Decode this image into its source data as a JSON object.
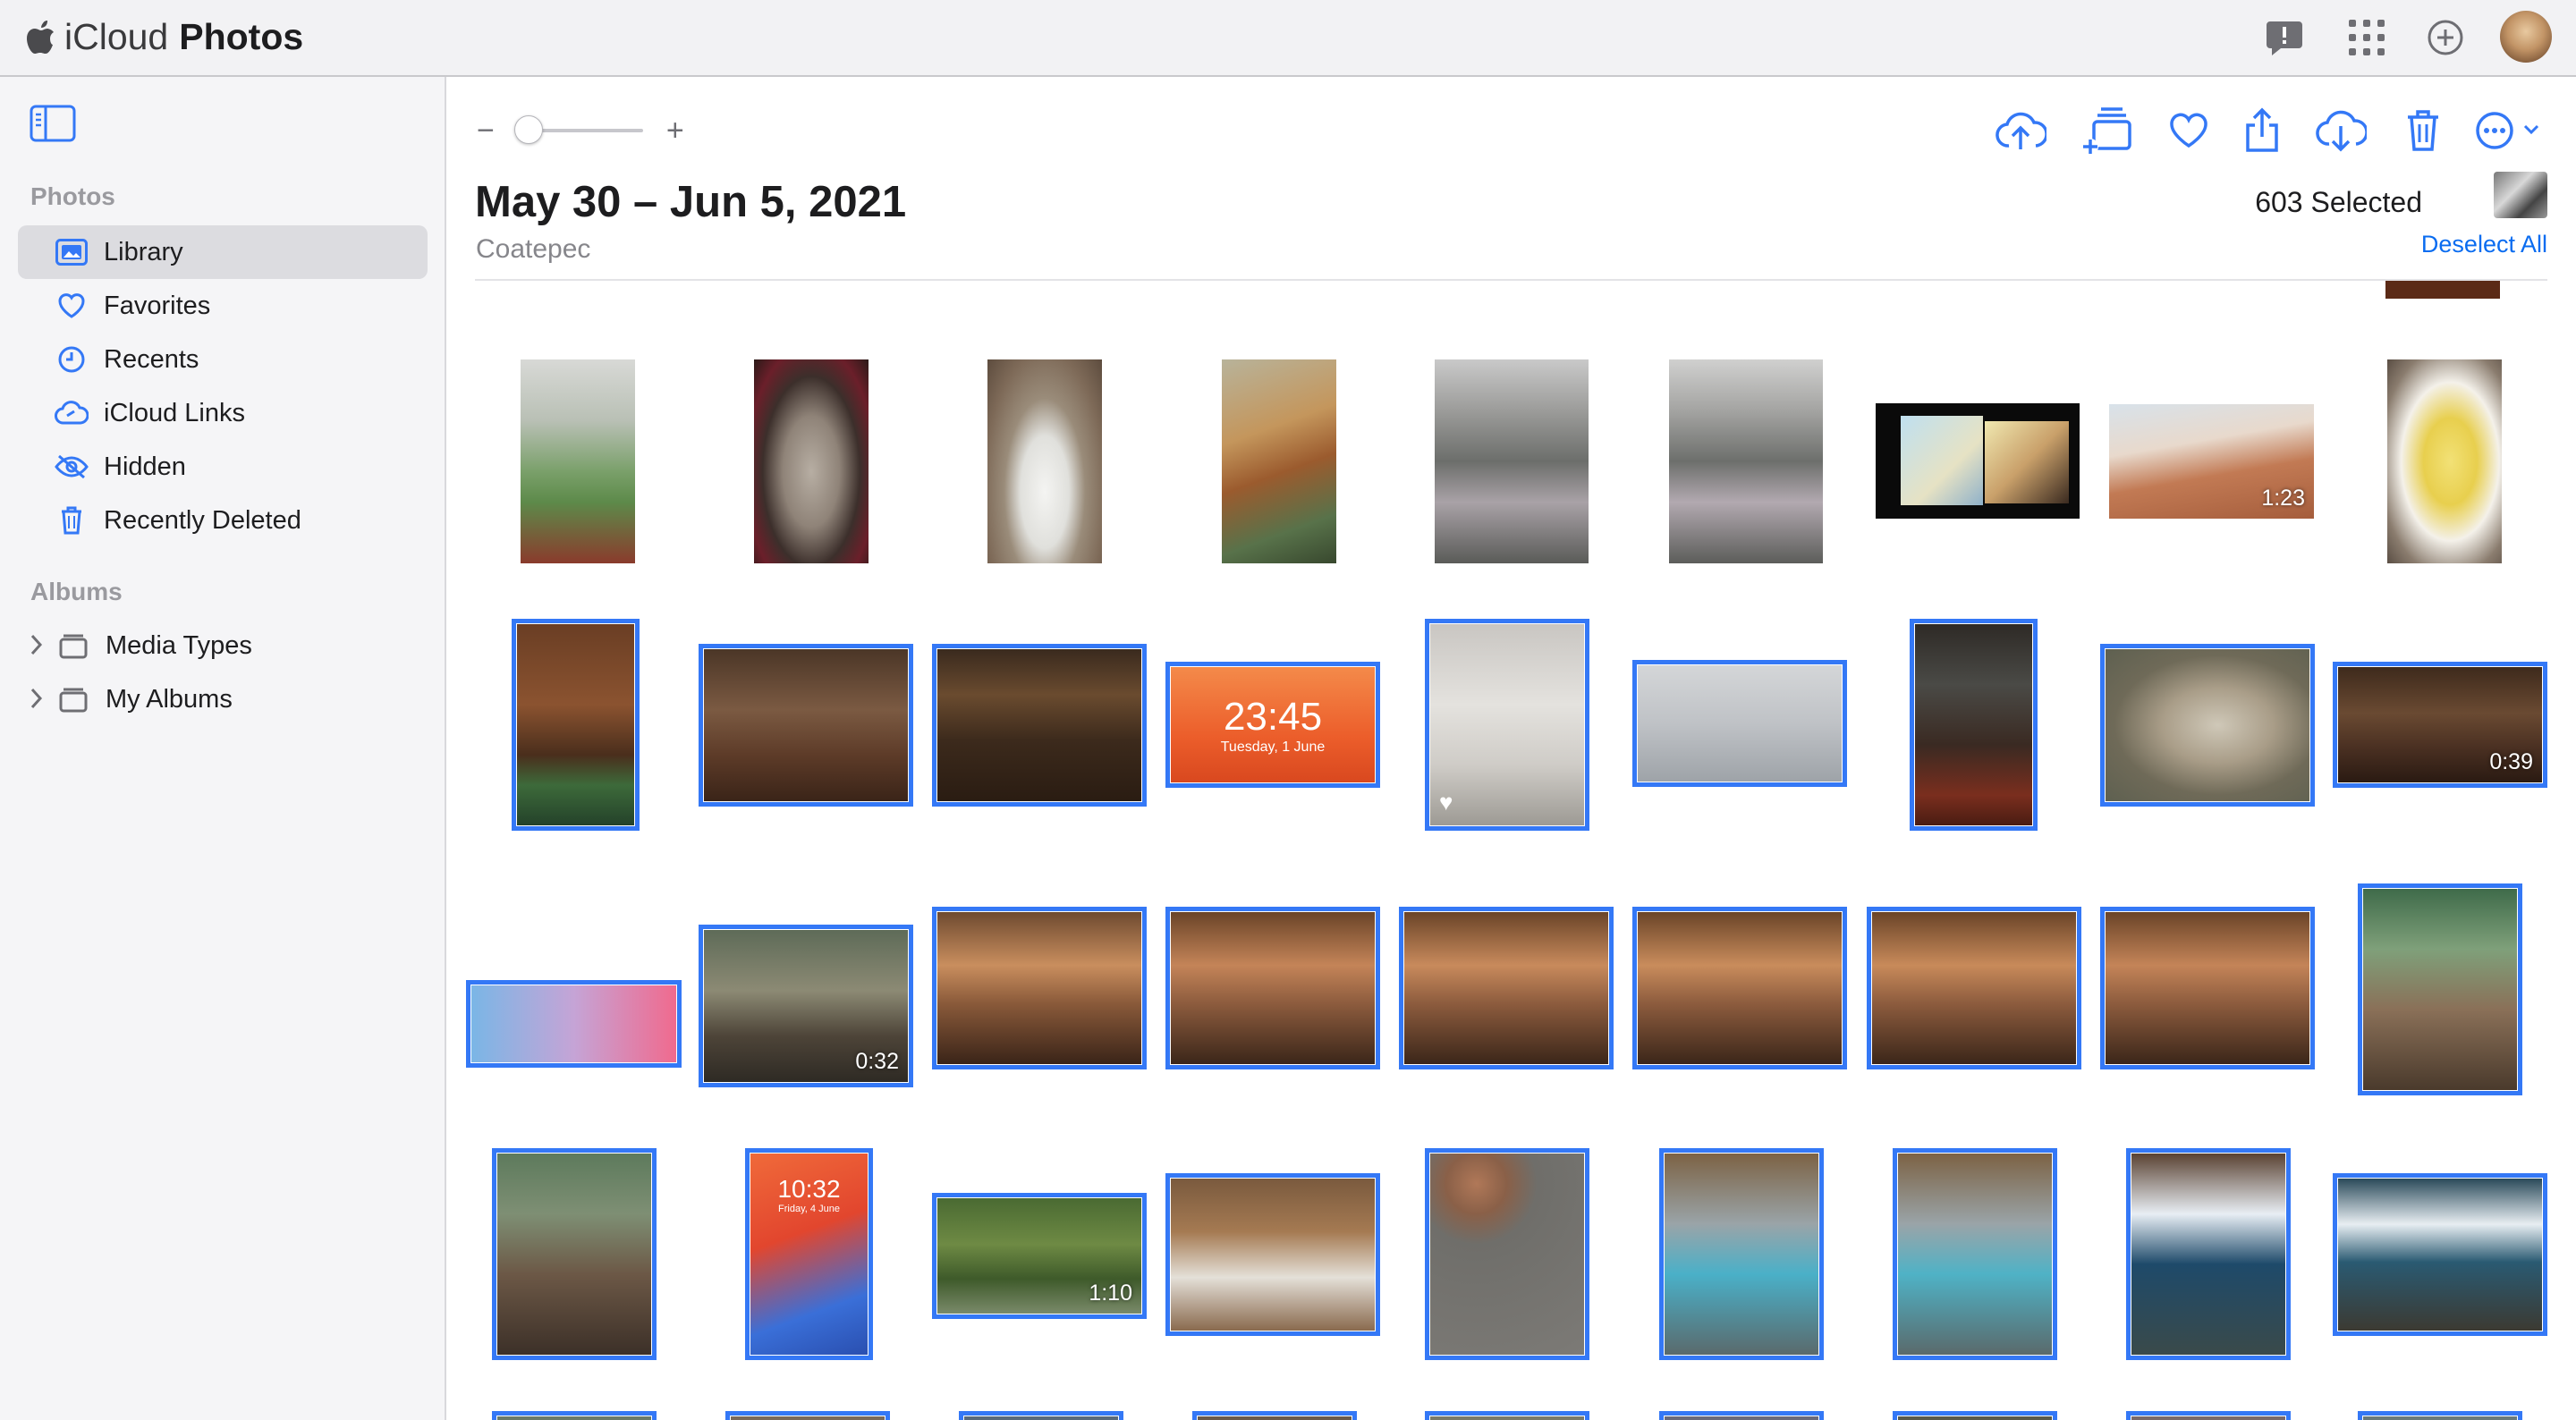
{
  "app": {
    "brand": "iCloud",
    "title": "Photos"
  },
  "sidebar": {
    "section_photos": "Photos",
    "items": [
      {
        "label": "Library",
        "icon": "library-icon",
        "active": true
      },
      {
        "label": "Favorites",
        "icon": "heart-icon"
      },
      {
        "label": "Recents",
        "icon": "clock-icon"
      },
      {
        "label": "iCloud Links",
        "icon": "link-cloud-icon"
      },
      {
        "label": "Hidden",
        "icon": "eye-slash-icon"
      },
      {
        "label": "Recently Deleted",
        "icon": "trash-icon"
      }
    ],
    "section_albums": "Albums",
    "albums": [
      {
        "label": "Media Types"
      },
      {
        "label": "My Albums"
      }
    ]
  },
  "header": {
    "date_range": "May 30 – Jun 5, 2021",
    "location": "Coatepec",
    "selected_count": "603 Selected",
    "deselect_label": "Deselect All",
    "zoom_minus": "−",
    "zoom_plus": "+",
    "zoom_level": 0
  },
  "durations": {
    "r1": "1:23",
    "r2": "0:39",
    "r3": "0:32",
    "r4": "1:10"
  },
  "lockscreens": {
    "a": {
      "time": "23:45",
      "date": "Tuesday, 1 June"
    },
    "b": {
      "time": "10:32",
      "date": "Friday, 4 June"
    }
  },
  "colors": {
    "accent": "#3478f6",
    "link": "#0a6cf0",
    "sidebar_bg": "#f5f5f7",
    "topbar_bg": "#f2f2f4"
  }
}
